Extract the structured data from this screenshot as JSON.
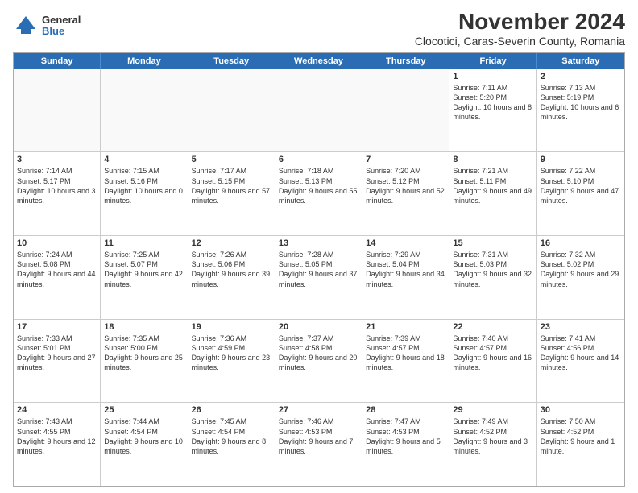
{
  "logo": {
    "general": "General",
    "blue": "Blue"
  },
  "title": {
    "month_year": "November 2024",
    "location": "Clocotici, Caras-Severin County, Romania"
  },
  "header_days": [
    "Sunday",
    "Monday",
    "Tuesday",
    "Wednesday",
    "Thursday",
    "Friday",
    "Saturday"
  ],
  "weeks": [
    {
      "cells": [
        {
          "day": "",
          "text": "",
          "empty": true
        },
        {
          "day": "",
          "text": "",
          "empty": true
        },
        {
          "day": "",
          "text": "",
          "empty": true
        },
        {
          "day": "",
          "text": "",
          "empty": true
        },
        {
          "day": "",
          "text": "",
          "empty": true
        },
        {
          "day": "1",
          "text": "Sunrise: 7:11 AM\nSunset: 5:20 PM\nDaylight: 10 hours and 8 minutes.",
          "empty": false
        },
        {
          "day": "2",
          "text": "Sunrise: 7:13 AM\nSunset: 5:19 PM\nDaylight: 10 hours and 6 minutes.",
          "empty": false
        }
      ]
    },
    {
      "cells": [
        {
          "day": "3",
          "text": "Sunrise: 7:14 AM\nSunset: 5:17 PM\nDaylight: 10 hours and 3 minutes.",
          "empty": false
        },
        {
          "day": "4",
          "text": "Sunrise: 7:15 AM\nSunset: 5:16 PM\nDaylight: 10 hours and 0 minutes.",
          "empty": false
        },
        {
          "day": "5",
          "text": "Sunrise: 7:17 AM\nSunset: 5:15 PM\nDaylight: 9 hours and 57 minutes.",
          "empty": false
        },
        {
          "day": "6",
          "text": "Sunrise: 7:18 AM\nSunset: 5:13 PM\nDaylight: 9 hours and 55 minutes.",
          "empty": false
        },
        {
          "day": "7",
          "text": "Sunrise: 7:20 AM\nSunset: 5:12 PM\nDaylight: 9 hours and 52 minutes.",
          "empty": false
        },
        {
          "day": "8",
          "text": "Sunrise: 7:21 AM\nSunset: 5:11 PM\nDaylight: 9 hours and 49 minutes.",
          "empty": false
        },
        {
          "day": "9",
          "text": "Sunrise: 7:22 AM\nSunset: 5:10 PM\nDaylight: 9 hours and 47 minutes.",
          "empty": false
        }
      ]
    },
    {
      "cells": [
        {
          "day": "10",
          "text": "Sunrise: 7:24 AM\nSunset: 5:08 PM\nDaylight: 9 hours and 44 minutes.",
          "empty": false
        },
        {
          "day": "11",
          "text": "Sunrise: 7:25 AM\nSunset: 5:07 PM\nDaylight: 9 hours and 42 minutes.",
          "empty": false
        },
        {
          "day": "12",
          "text": "Sunrise: 7:26 AM\nSunset: 5:06 PM\nDaylight: 9 hours and 39 minutes.",
          "empty": false
        },
        {
          "day": "13",
          "text": "Sunrise: 7:28 AM\nSunset: 5:05 PM\nDaylight: 9 hours and 37 minutes.",
          "empty": false
        },
        {
          "day": "14",
          "text": "Sunrise: 7:29 AM\nSunset: 5:04 PM\nDaylight: 9 hours and 34 minutes.",
          "empty": false
        },
        {
          "day": "15",
          "text": "Sunrise: 7:31 AM\nSunset: 5:03 PM\nDaylight: 9 hours and 32 minutes.",
          "empty": false
        },
        {
          "day": "16",
          "text": "Sunrise: 7:32 AM\nSunset: 5:02 PM\nDaylight: 9 hours and 29 minutes.",
          "empty": false
        }
      ]
    },
    {
      "cells": [
        {
          "day": "17",
          "text": "Sunrise: 7:33 AM\nSunset: 5:01 PM\nDaylight: 9 hours and 27 minutes.",
          "empty": false
        },
        {
          "day": "18",
          "text": "Sunrise: 7:35 AM\nSunset: 5:00 PM\nDaylight: 9 hours and 25 minutes.",
          "empty": false
        },
        {
          "day": "19",
          "text": "Sunrise: 7:36 AM\nSunset: 4:59 PM\nDaylight: 9 hours and 23 minutes.",
          "empty": false
        },
        {
          "day": "20",
          "text": "Sunrise: 7:37 AM\nSunset: 4:58 PM\nDaylight: 9 hours and 20 minutes.",
          "empty": false
        },
        {
          "day": "21",
          "text": "Sunrise: 7:39 AM\nSunset: 4:57 PM\nDaylight: 9 hours and 18 minutes.",
          "empty": false
        },
        {
          "day": "22",
          "text": "Sunrise: 7:40 AM\nSunset: 4:57 PM\nDaylight: 9 hours and 16 minutes.",
          "empty": false
        },
        {
          "day": "23",
          "text": "Sunrise: 7:41 AM\nSunset: 4:56 PM\nDaylight: 9 hours and 14 minutes.",
          "empty": false
        }
      ]
    },
    {
      "cells": [
        {
          "day": "24",
          "text": "Sunrise: 7:43 AM\nSunset: 4:55 PM\nDaylight: 9 hours and 12 minutes.",
          "empty": false
        },
        {
          "day": "25",
          "text": "Sunrise: 7:44 AM\nSunset: 4:54 PM\nDaylight: 9 hours and 10 minutes.",
          "empty": false
        },
        {
          "day": "26",
          "text": "Sunrise: 7:45 AM\nSunset: 4:54 PM\nDaylight: 9 hours and 8 minutes.",
          "empty": false
        },
        {
          "day": "27",
          "text": "Sunrise: 7:46 AM\nSunset: 4:53 PM\nDaylight: 9 hours and 7 minutes.",
          "empty": false
        },
        {
          "day": "28",
          "text": "Sunrise: 7:47 AM\nSunset: 4:53 PM\nDaylight: 9 hours and 5 minutes.",
          "empty": false
        },
        {
          "day": "29",
          "text": "Sunrise: 7:49 AM\nSunset: 4:52 PM\nDaylight: 9 hours and 3 minutes.",
          "empty": false
        },
        {
          "day": "30",
          "text": "Sunrise: 7:50 AM\nSunset: 4:52 PM\nDaylight: 9 hours and 1 minute.",
          "empty": false
        }
      ]
    }
  ]
}
